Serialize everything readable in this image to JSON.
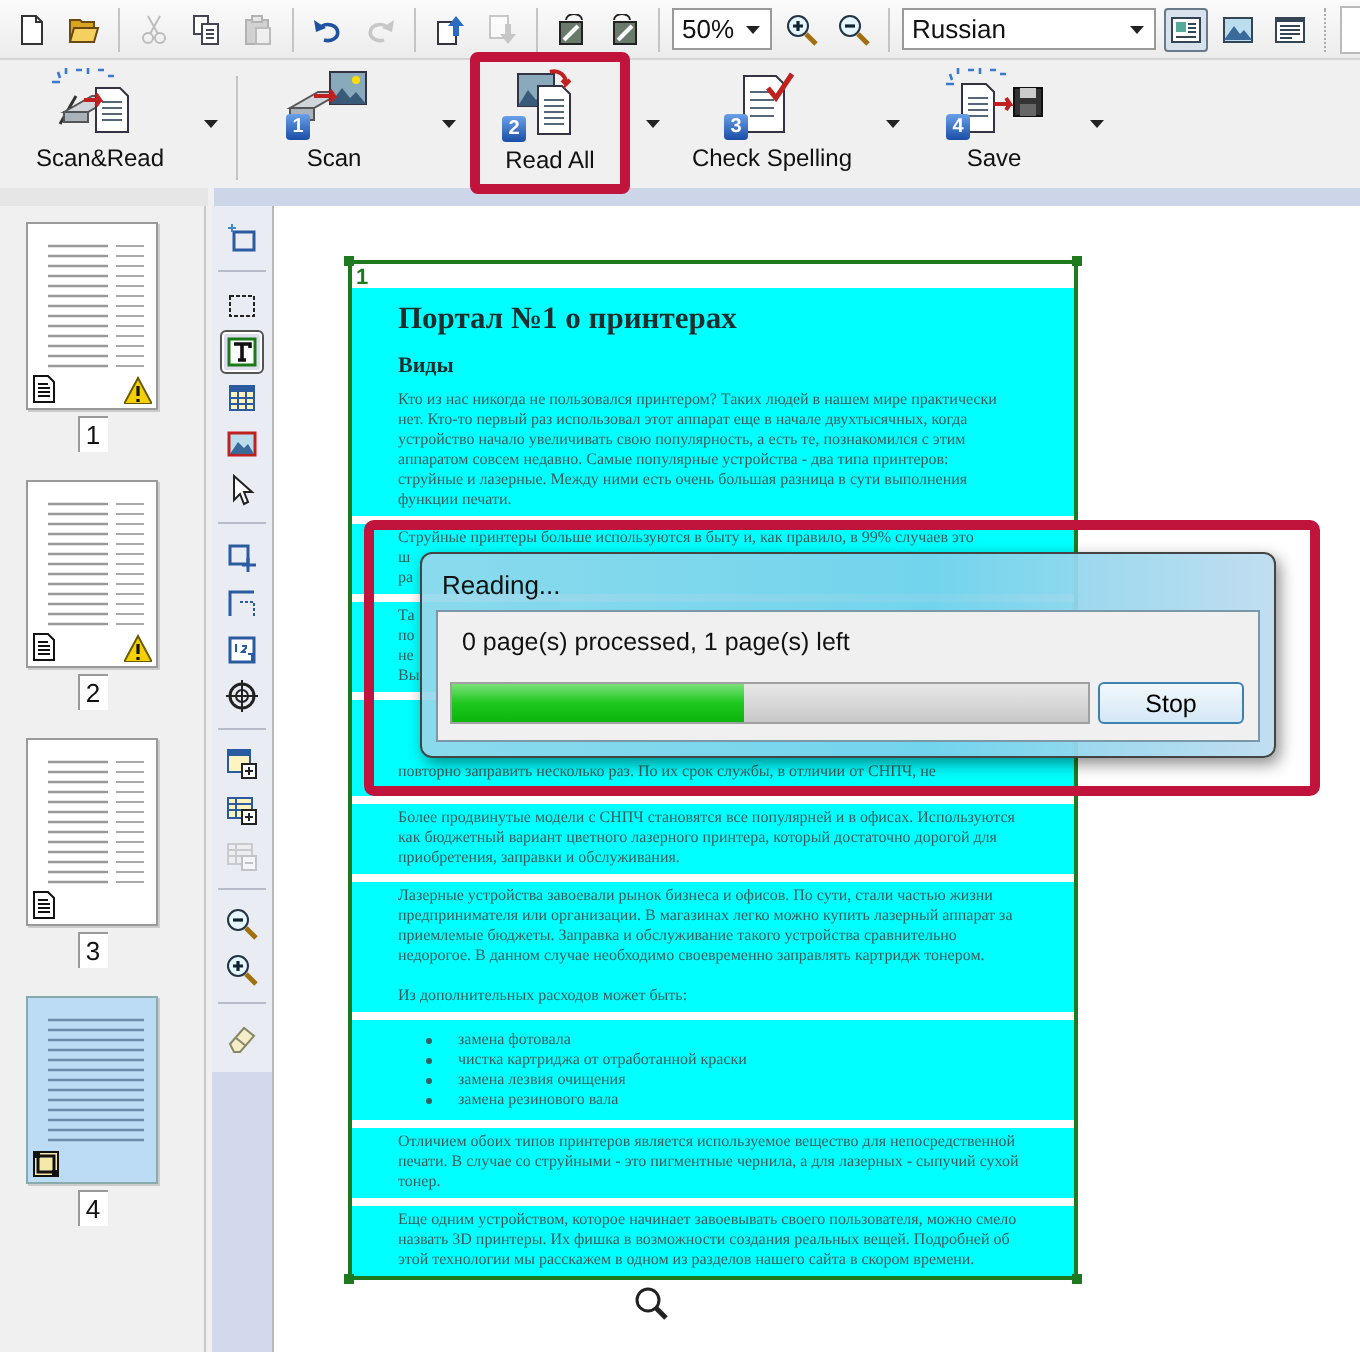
{
  "toolbar": {
    "items": [
      {
        "kind": "new",
        "disabled": false
      },
      {
        "kind": "open",
        "disabled": false
      },
      {
        "kind": "sep"
      },
      {
        "kind": "cut",
        "disabled": true
      },
      {
        "kind": "copy",
        "disabled": false
      },
      {
        "kind": "paste",
        "disabled": true
      },
      {
        "kind": "sep"
      },
      {
        "kind": "undo",
        "disabled": false
      },
      {
        "kind": "redo",
        "disabled": true
      },
      {
        "kind": "sep"
      },
      {
        "kind": "up",
        "disabled": false
      },
      {
        "kind": "down",
        "disabled": true
      },
      {
        "kind": "sep"
      },
      {
        "kind": "rotate-left",
        "disabled": false
      },
      {
        "kind": "rotate-right",
        "disabled": false
      },
      {
        "kind": "sep"
      }
    ],
    "zoom": "50%",
    "language": "Russian",
    "views": [
      {
        "kind": "page",
        "selected": true
      },
      {
        "kind": "image",
        "selected": false
      },
      {
        "kind": "text",
        "selected": false
      }
    ]
  },
  "main_toolbar": [
    {
      "kind": "scan-read",
      "label": "Scan&Read",
      "highlighted": false
    },
    {
      "kind": "scan",
      "step": "1",
      "label": "Scan",
      "highlighted": false
    },
    {
      "kind": "read",
      "step": "2",
      "label": "Read All",
      "highlighted": true
    },
    {
      "kind": "spell",
      "step": "3",
      "label": "Check Spelling",
      "highlighted": false
    },
    {
      "kind": "save",
      "step": "4",
      "label": "Save",
      "highlighted": false
    }
  ],
  "pages": [
    {
      "number": "1",
      "kind": "text",
      "warning": true,
      "selected": false
    },
    {
      "number": "2",
      "kind": "text",
      "warning": true,
      "selected": false
    },
    {
      "number": "3",
      "kind": "text",
      "warning": false,
      "selected": false
    },
    {
      "number": "4",
      "kind": "area",
      "warning": false,
      "selected": true
    }
  ],
  "tools": [
    {
      "kind": "magic-area",
      "selected": false,
      "disabled": false
    },
    {
      "kind": "sep"
    },
    {
      "kind": "area",
      "selected": false,
      "disabled": false
    },
    {
      "kind": "text",
      "selected": true,
      "disabled": false
    },
    {
      "kind": "table",
      "selected": false,
      "disabled": false
    },
    {
      "kind": "picture",
      "selected": false,
      "disabled": false
    },
    {
      "kind": "pointer",
      "selected": false,
      "disabled": false
    },
    {
      "kind": "sep"
    },
    {
      "kind": "add-area",
      "selected": false,
      "disabled": false
    },
    {
      "kind": "cut-area",
      "selected": false,
      "disabled": false
    },
    {
      "kind": "order",
      "selected": false,
      "disabled": false
    },
    {
      "kind": "target",
      "selected": false,
      "disabled": false
    },
    {
      "kind": "sep"
    },
    {
      "kind": "table-add",
      "selected": false,
      "disabled": false
    },
    {
      "kind": "table-add-row",
      "selected": false,
      "disabled": false
    },
    {
      "kind": "table-remove",
      "selected": false,
      "disabled": true
    },
    {
      "kind": "sep"
    },
    {
      "kind": "zoom-out",
      "selected": false,
      "disabled": false
    },
    {
      "kind": "zoom-in",
      "selected": false,
      "disabled": false
    },
    {
      "kind": "sep"
    },
    {
      "kind": "eraser",
      "selected": false,
      "disabled": false
    }
  ],
  "document": {
    "page_number": "1",
    "areas": [
      {
        "items": [
          {
            "kind": "title",
            "text": "Портал №1 о принтерах"
          },
          {
            "kind": "subtitle",
            "text": "Виды"
          },
          {
            "kind": "paragraph",
            "lines": [
              "Кто из нас никогда не пользовался принтером? Таких людей в нашем мире практически",
              "нет. Кто-то первый раз использовал этот аппарат еще в начале двухтысячных, когда",
              "устройство начало увеличивать свою популярность, а есть те, познакомился с этим",
              "аппаратом совсем недавно. Самые популярные устройства - два типа принтеров:",
              "струйные и лазерные. Между ними есть очень большая разница в сути выполнения",
              "функции печати."
            ]
          }
        ]
      },
      {
        "items": [
          {
            "kind": "paragraph",
            "lines": [
              "Струйные принтеры больше используются в быту и, как правило, в 99% случаев это",
              "ш",
              "ра"
            ]
          }
        ]
      },
      {
        "items": [
          {
            "kind": "paragraph",
            "lines": [
              "Та",
              "по",
              "не",
              "Вы"
            ]
          }
        ]
      },
      {
        "items": [
          {
            "kind": "paragraph",
            "lines": [
              "повторно заправить несколько раз. По их срок службы, в отличии от СНПЧ, не"
            ]
          }
        ]
      },
      {
        "items": [
          {
            "kind": "paragraph",
            "lines": [
              "Более продвинутые модели с СНПЧ становятся все популярней и в офисах. Используются",
              "как бюджетный вариант цветного лазерного принтера, который достаточно дорогой для",
              "приобретения, заправки и обслуживания."
            ]
          }
        ]
      },
      {
        "items": [
          {
            "kind": "paragraph",
            "lines": [
              "Лазерные устройства завоевали рынок бизнеса и офисов. По сути, стали частью жизни",
              "предпринимателя или организации. В магазинах легко можно купить лазерный аппарат за",
              "приемлемые бюджеты. Заправка и обслуживание такого устройства сравнительно",
              "недорогое. В данном случае необходимо своевременно заправлять картридж тонером."
            ]
          },
          {
            "kind": "paragraph",
            "lines": [
              "Из дополнительных расходов может быть:"
            ]
          }
        ]
      },
      {
        "items": [
          {
            "kind": "list",
            "items": [
              "замена фотовала",
              "чистка картриджа от отработанной краски",
              "замена лезвия очищения",
              "замена резинового вала"
            ]
          }
        ]
      },
      {
        "items": [
          {
            "kind": "paragraph",
            "lines": [
              "Отличием обоих типов принтеров является используемое вещество для непосредственной",
              "печати. В случае со струйными - это пигментные чернила, а для лазерных - сыпучий сухой",
              "тонер."
            ]
          }
        ]
      },
      {
        "items": [
          {
            "kind": "paragraph",
            "lines": [
              "Еще одним устройством, которое начинает завоевывать своего пользователя, можно смело",
              "назвать 3D принтеры. Их фишка в возможности создания реальных вещей. Подробней об",
              "этой технологии мы расскажем в одном из разделов нашего сайта в скором времени."
            ]
          }
        ]
      }
    ]
  },
  "dialog": {
    "title": "Reading...",
    "highlighted": true,
    "message": "0 page(s) processed, 1 page(s) left",
    "progress": {
      "level": 0.46
    },
    "button": "Stop"
  }
}
